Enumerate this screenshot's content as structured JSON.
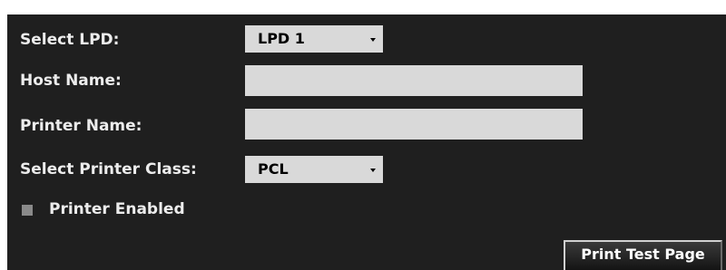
{
  "form": {
    "select_lpd": {
      "label": "Select LPD:",
      "value": "LPD 1"
    },
    "host_name": {
      "label": "Host Name:",
      "value": ""
    },
    "printer_name": {
      "label": "Printer Name:",
      "value": ""
    },
    "printer_class": {
      "label": "Select Printer Class:",
      "value": "PCL"
    },
    "printer_enabled": {
      "label": "Printer Enabled",
      "checked": false
    }
  },
  "actions": {
    "print_test_page": "Print Test Page"
  },
  "colors": {
    "panel_background": "#1f1f1f",
    "field_background": "#d9d9d9",
    "label_text": "#ececec",
    "checkbox_fill": "#8a8a8a"
  },
  "icons": {
    "dropdown": "caret-down-icon"
  }
}
